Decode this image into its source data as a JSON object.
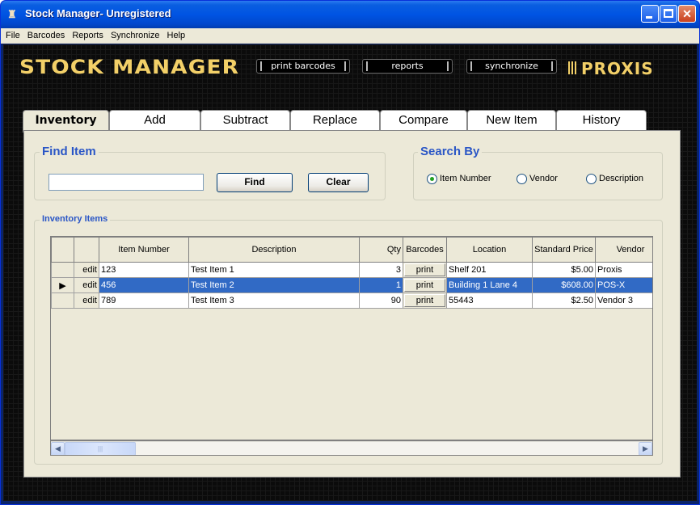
{
  "window": {
    "title": "Stock Manager- Unregistered",
    "app_icon": "app-icon"
  },
  "menu": [
    "File",
    "Barcodes",
    "Reports",
    "Synchronize",
    "Help"
  ],
  "header": {
    "logo": "STOCK MANAGER",
    "buttons": [
      "print barcodes",
      "reports",
      "synchronize"
    ],
    "brand": "PROXIS"
  },
  "tabs": [
    "Inventory",
    "Add",
    "Subtract",
    "Replace",
    "Compare",
    "New Item",
    "History"
  ],
  "active_tab": "Inventory",
  "find": {
    "title": "Find Item",
    "input_value": "",
    "find_label": "Find",
    "clear_label": "Clear"
  },
  "search_by": {
    "title": "Search By",
    "options": [
      "Item Number",
      "Vendor",
      "Description"
    ],
    "selected": "Item Number"
  },
  "inventory": {
    "title": "Inventory Items",
    "columns": [
      "",
      "",
      "Item Number",
      "Description",
      "Qty",
      "Barcodes",
      "Location",
      "Standard Price",
      "Vendor"
    ],
    "edit_label": "edit",
    "print_label": "print",
    "rows": [
      {
        "item": "123",
        "description": "Test Item 1",
        "qty": "3",
        "location": "Shelf 201",
        "price": "$5.00",
        "vendor": "Proxis",
        "selected": false
      },
      {
        "item": "456",
        "description": "Test Item 2",
        "qty": "1",
        "location": "Building 1 Lane 4",
        "price": "$608.00",
        "vendor": "POS-X",
        "selected": true
      },
      {
        "item": "789",
        "description": "Test Item 3",
        "qty": "90",
        "location": "55443",
        "price": "$2.50",
        "vendor": "Vendor 3",
        "selected": false
      }
    ]
  },
  "colors": {
    "titlebar": "#0054e3",
    "group_title": "#2a56c6",
    "logo": "#f3d068",
    "selection": "#316ac5"
  }
}
